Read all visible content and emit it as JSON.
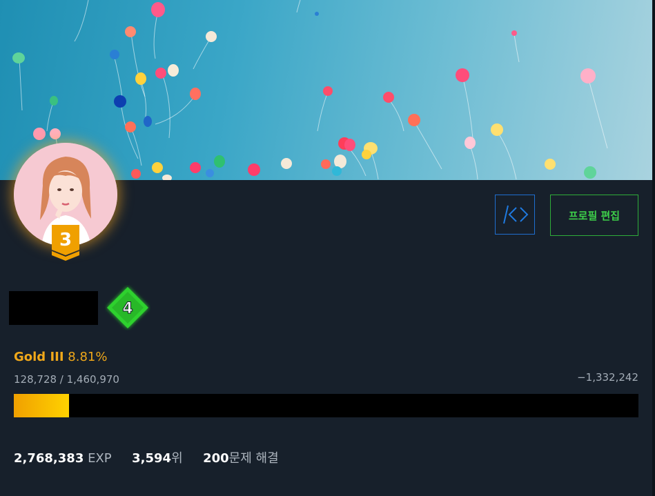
{
  "profile": {
    "rank_badge": "3",
    "tier_level_badge": "4",
    "edit_button_label": "프로필 편집",
    "code_button_icon": "code-bracket-icon"
  },
  "tier": {
    "name": "Gold III",
    "percent": "8.81%",
    "exp_progress": "128,728 / 1,460,970",
    "exp_remaining": "−1,332,242",
    "progress_fraction": 0.0881
  },
  "stats": {
    "exp_value": "2,768,383",
    "exp_unit": "EXP",
    "rank_value": "3,594",
    "rank_unit": "위",
    "solved_value": "200",
    "solved_unit": "문제 해결"
  },
  "colors": {
    "gold": "#f0a81a",
    "edit_green": "#3ecf4a",
    "code_blue": "#1f6fd1",
    "background": "#17202b"
  }
}
